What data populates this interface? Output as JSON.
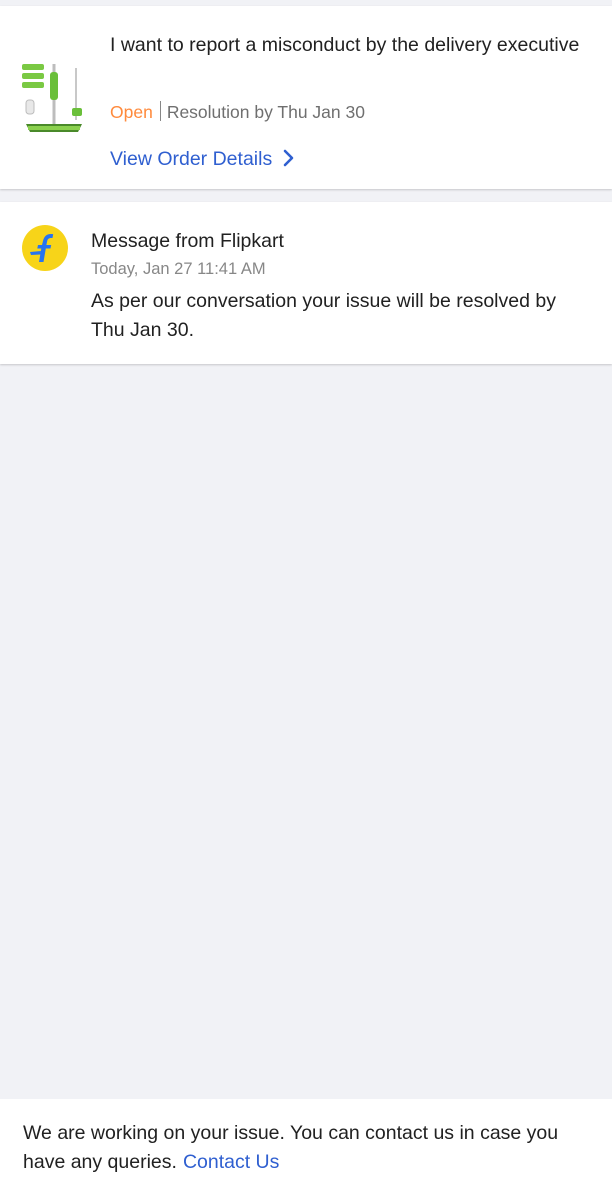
{
  "issue": {
    "title": "I want to report a misconduct by the delivery executive",
    "status": "Open",
    "resolution": "Resolution by Thu Jan 30",
    "view_order_label": "View Order Details",
    "status_color": "#ff8a3c"
  },
  "message": {
    "from": "Message from Flipkart",
    "time": "Today, Jan 27 11:41 AM",
    "body": "As per our conversation your issue will be resolved by Thu Jan 30.",
    "logo_color": "#f7d419"
  },
  "footer": {
    "text": "We are working on your issue. You can contact us in case you have any queries.",
    "contact_label": "Contact Us"
  },
  "colors": {
    "link": "#2f5fd0",
    "background": "#f1f2f6"
  },
  "icons": {
    "product": "spray-mop-product-thumbnail",
    "chevron": "chevron-right-icon",
    "brand": "flipkart-logo-icon"
  }
}
